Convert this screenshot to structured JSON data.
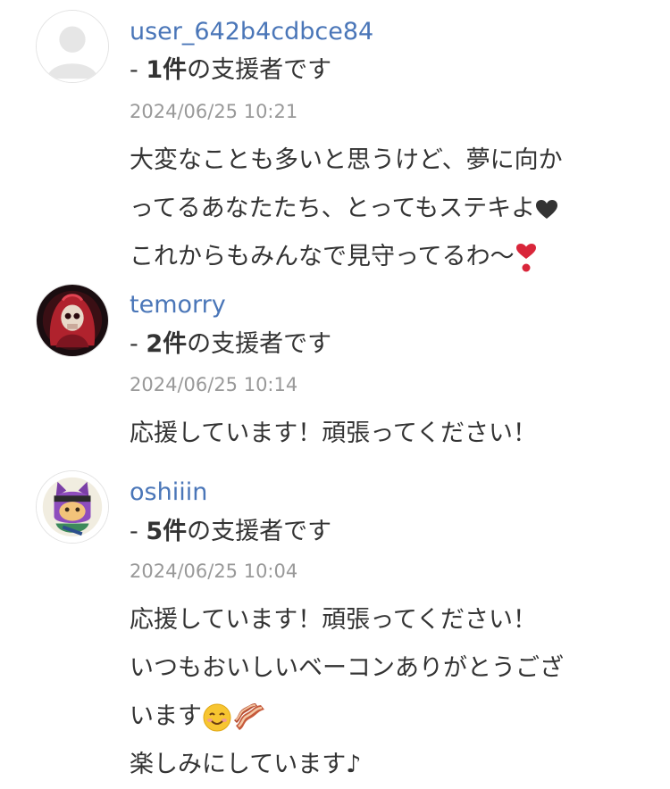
{
  "comments": [
    {
      "username": "user_642b4cdbce84",
      "supporter_prefix": "- ",
      "supporter_count": "1件",
      "supporter_suffix": "の支援者です",
      "date": "2024/06/25 10:21",
      "lines": [
        "大変なことも多いと思うけど、夢に向か",
        "ってるあなたたち、とってもステキよ",
        "これからもみんなで見守ってるわ〜"
      ],
      "avatar_icon": "default-user-icon"
    },
    {
      "username": "temorry",
      "supporter_prefix": "- ",
      "supporter_count": "2件",
      "supporter_suffix": "の支援者です",
      "date": "2024/06/25 10:14",
      "lines": [
        "応援しています！頑張ってください！"
      ],
      "avatar_icon": "skull-hood-avatar"
    },
    {
      "username": "oshiiin",
      "supporter_prefix": "- ",
      "supporter_count": "5件",
      "supporter_suffix": "の支援者です",
      "date": "2024/06/25 10:04",
      "lines": [
        "応援しています！頑張ってください！",
        "いつもおいしいベーコンありがとうござ",
        "います",
        "楽しみにしています♪"
      ],
      "avatar_icon": "ninja-cat-avatar"
    }
  ],
  "colors": {
    "username": "#4a76b8",
    "text": "#333333",
    "date": "#999999"
  }
}
